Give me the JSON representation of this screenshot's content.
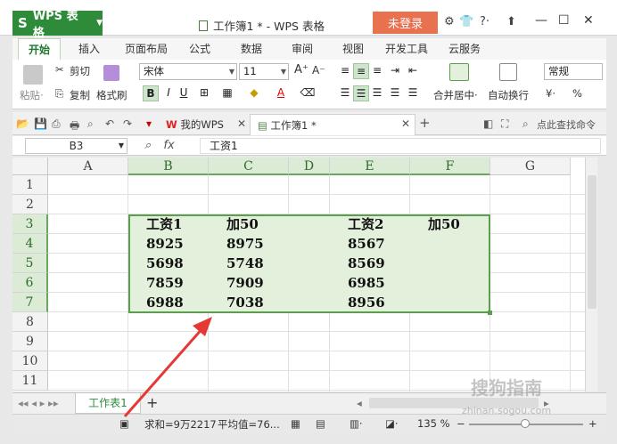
{
  "app": {
    "logo_glyph": "S",
    "name": "WPS 表格",
    "doc_title": "工作簿1 * - WPS 表格",
    "login_label": "未登录",
    "help_label": "?·"
  },
  "ribbon_tabs": [
    "开始",
    "插入",
    "页面布局",
    "公式",
    "数据",
    "审阅",
    "视图",
    "开发工具",
    "云服务"
  ],
  "ribbon": {
    "paste": "粘贴·",
    "cut": "剪切",
    "copy": "复制",
    "format_painter": "格式刷",
    "font_name": "宋体",
    "font_size": "11",
    "merge_center": "合并居中·",
    "wrap_text": "自动换行",
    "number_format": "常规",
    "percent": "%"
  },
  "doc_tabs": {
    "my_wps": "我的WPS",
    "workbook": "工作簿1 *",
    "search": "点此查找命令"
  },
  "formula_bar": {
    "cell_ref": "B3",
    "fx": "fx",
    "content": "工资1"
  },
  "grid": {
    "columns": [
      "A",
      "B",
      "C",
      "D",
      "E",
      "F",
      "G"
    ],
    "rows": [
      "1",
      "2",
      "3",
      "4",
      "5",
      "6",
      "7",
      "8",
      "9",
      "10",
      "11"
    ],
    "cells": {
      "B3": "工资1",
      "C3": "加50",
      "E3": "工资2",
      "F3": "加50",
      "B4": "8925",
      "C4": "8975",
      "E4": "8567",
      "B5": "5698",
      "C5": "5748",
      "E5": "8569",
      "B6": "7859",
      "C6": "7909",
      "E6": "6985",
      "B7": "6988",
      "C7": "7038",
      "E7": "8956"
    }
  },
  "sheet_tabs": [
    "工作表1"
  ],
  "status": {
    "sum": "求和=9万2217",
    "average": "平均值=76...",
    "zoom": "135 %"
  },
  "watermark": {
    "brand": "搜狗指南",
    "url": "zhinan.sogou.com"
  },
  "colors": {
    "brand_green": "#2e8b3a",
    "login_orange": "#e8714f",
    "selection_fill": "#e2f0dc",
    "selection_border": "#5a9e4e",
    "arrow_red": "#e53935"
  }
}
